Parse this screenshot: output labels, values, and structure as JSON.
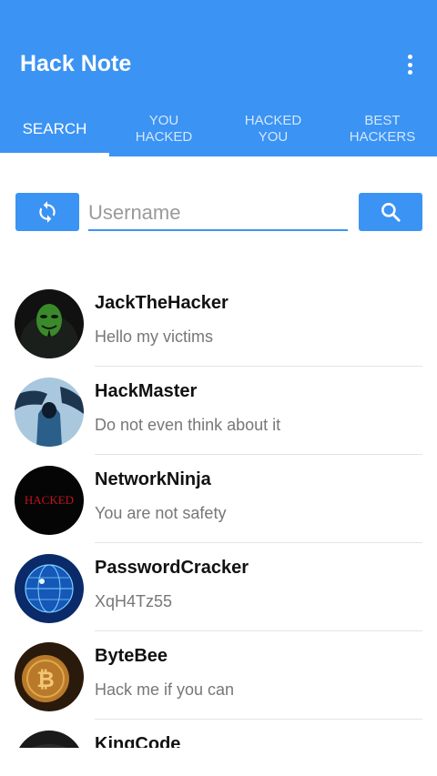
{
  "appbar": {
    "title": "Hack Note",
    "overflow_icon": "more-vert-icon",
    "color": "#3b93f3"
  },
  "tabs": [
    {
      "label": "SEARCH",
      "active": true
    },
    {
      "label": "YOU\nHACKED",
      "active": false
    },
    {
      "label": "HACKED\nYOU",
      "active": false
    },
    {
      "label": "BEST\nHACKERS",
      "active": false
    }
  ],
  "search": {
    "refresh_icon": "refresh-icon",
    "placeholder": "Username",
    "value": "",
    "search_icon": "search-icon"
  },
  "users": [
    {
      "name": "JackTheHacker",
      "status": "Hello my victims",
      "avatar": "anonymous-mask-avatar"
    },
    {
      "name": "HackMaster",
      "status": "Do not even think about it",
      "avatar": "hooded-hacker-avatar"
    },
    {
      "name": "NetworkNinja",
      "status": "You are not safety",
      "avatar": "hacked-text-avatar",
      "avatar_text": "HACKED"
    },
    {
      "name": "PasswordCracker",
      "status": "XqH4Tz55",
      "avatar": "digital-globe-avatar"
    },
    {
      "name": "ByteBee",
      "status": "Hack me if you can",
      "avatar": "bitcoin-avatar"
    },
    {
      "name": "KingCode",
      "status": "",
      "avatar": "dark-avatar"
    }
  ]
}
